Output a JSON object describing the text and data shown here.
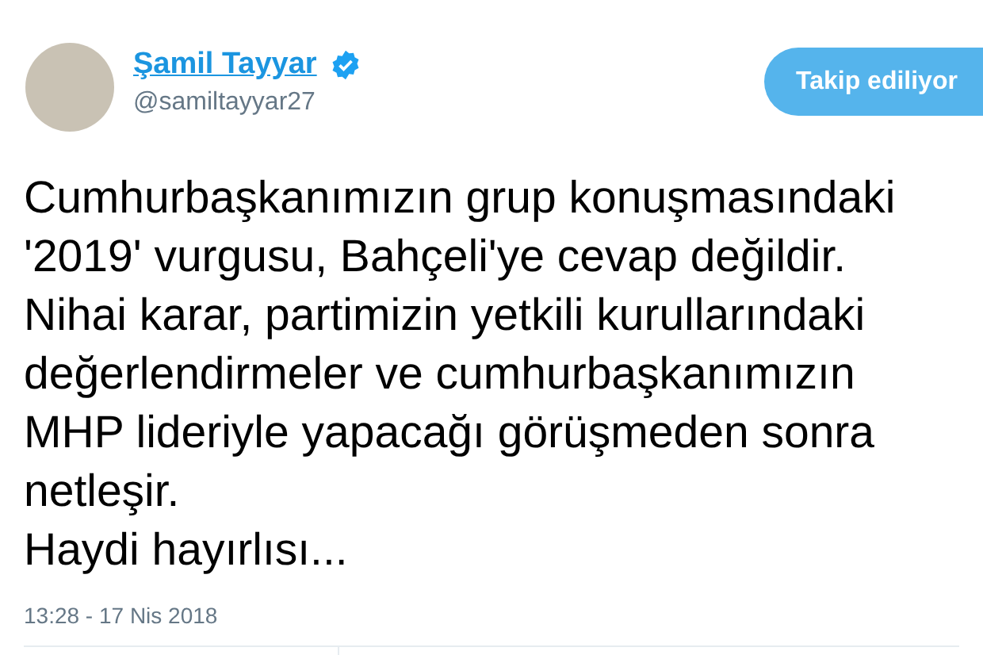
{
  "author": {
    "name": "Şamil Tayyar",
    "verified": true,
    "handle": "@samiltayyar27"
  },
  "follow_button": {
    "label": "Takip ediliyor",
    "following": true
  },
  "tweet_text": "Cumhurbaşkanımızın grup konuşmasındaki\n'2019' vurgusu, Bahçeli'ye cevap değildir.\nNihai karar, partimizin yetkili kurullarındaki\ndeğerlendirmeler ve cumhurbaşkanımızın\nMHP lideriyle yapacağı görüşmeden sonra\nnetleşir.\nHaydi hayırlısı...",
  "timestamp": "13:28 - 17 Nis 2018"
}
